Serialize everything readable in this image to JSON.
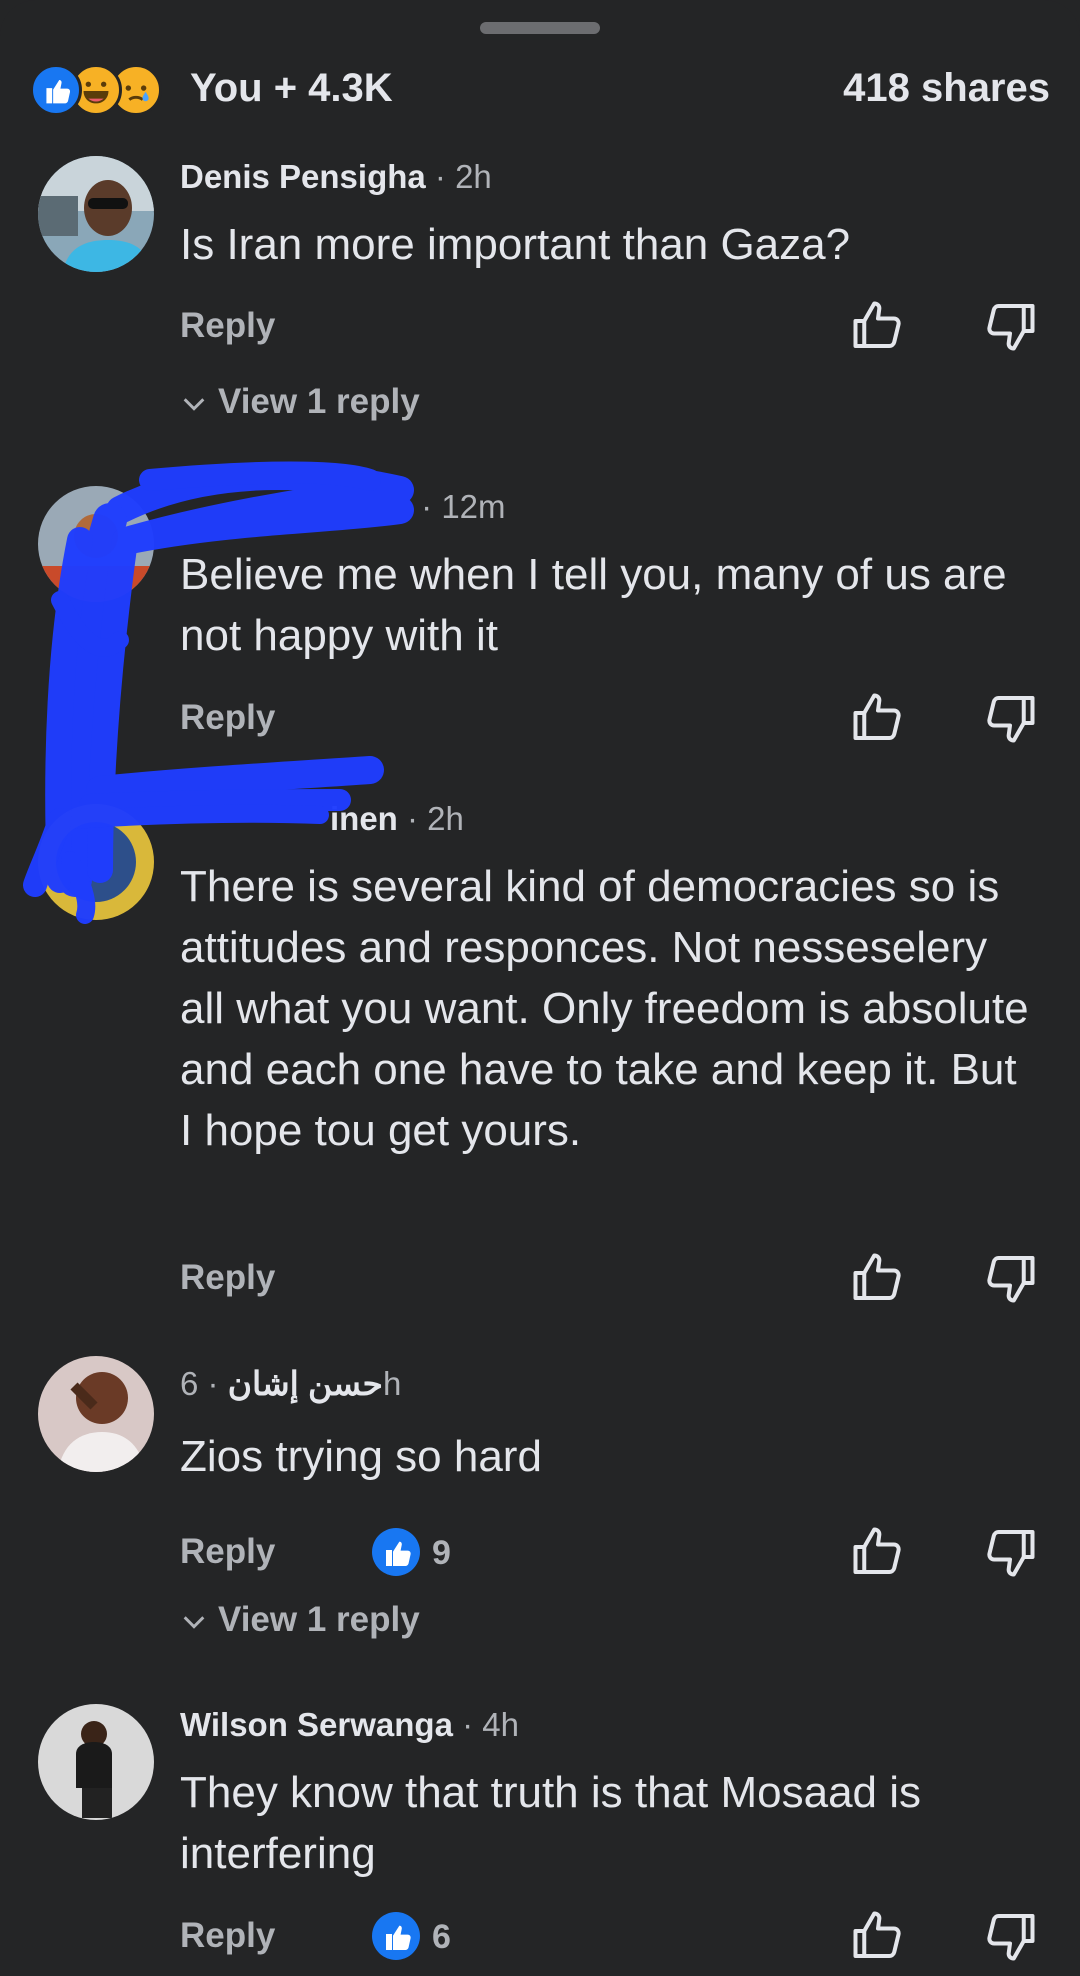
{
  "reactions": {
    "icons": [
      "like-icon",
      "haha-icon",
      "sad-icon"
    ],
    "count_text": "You + 4.3K",
    "shares_text": "418 shares"
  },
  "actions": {
    "reply_label": "Reply",
    "view_replies_label": "View 1 reply"
  },
  "colors": {
    "background": "#242526",
    "text": "#e4e6eb",
    "muted": "#b0b3b8",
    "accent": "#1877f2",
    "redaction": "#1f3dff"
  },
  "comments": [
    {
      "author": "Denis Pensigha",
      "time": "· 2h",
      "text": "Is Iran more important than Gaza?"
    },
    {
      "author": "",
      "time": "· 12m",
      "text": "Believe me when I tell you, many of us are not happy with it"
    },
    {
      "author": "inen",
      "time": "· 2h",
      "text": "There is several kind of democracies so is attitudes and responces. Not nesseselery all what you want. Only freedom is absolute and each one have to take and keep it. But I hope tou get yours."
    },
    {
      "author": "حسن إشان",
      "time": "· 6h",
      "text": "Zios trying so hard",
      "likes": "9"
    },
    {
      "author": "Wilson Serwanga",
      "time": "· 4h",
      "text": "They know that truth is that Mosaad is interfering",
      "likes": "6"
    }
  ]
}
